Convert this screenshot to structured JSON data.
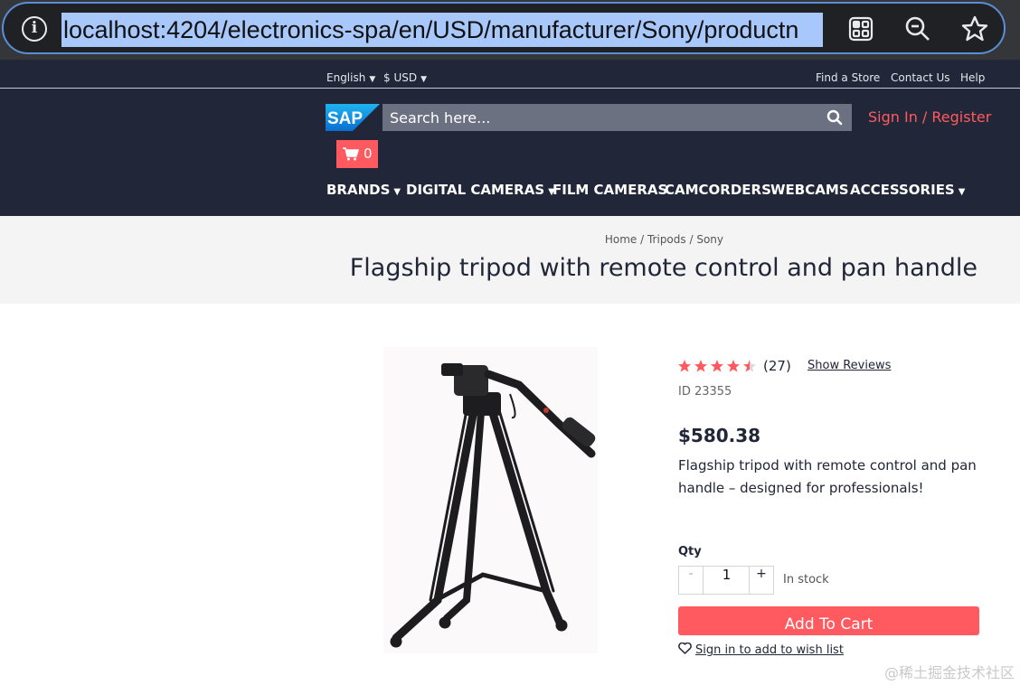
{
  "browser": {
    "url": "localhost:4204/electronics-spa/en/USD/manufacturer/Sony/productn"
  },
  "header": {
    "language": "English",
    "currency": "$ USD",
    "utility_links": [
      "Find a Store",
      "Contact Us",
      "Help"
    ],
    "logo_text": "SAP",
    "search_placeholder": "Search here...",
    "signin": "Sign In / Register",
    "cart_count": "0",
    "nav": [
      "BRANDS",
      "DIGITAL CAMERAS",
      "FILM CAMERAS",
      "CAMCORDERS",
      "WEBCAMS",
      "ACCESSORIES"
    ]
  },
  "breadcrumb": [
    "Home",
    "Tripods",
    "Sony"
  ],
  "product": {
    "title": "Flagship tripod with remote control and pan handle",
    "rating": 4.5,
    "review_count": "(27)",
    "show_reviews": "Show Reviews",
    "id": "ID 23355",
    "price": "$580.38",
    "summary": "Flagship tripod with remote control and pan handle – designed for professionals!",
    "qty_label": "Qty",
    "qty_minus": "-",
    "qty_value": "1",
    "qty_plus": "+",
    "stock": "In stock",
    "add_to_cart": "Add To Cart",
    "wishlist": "Sign in to add to wish list"
  },
  "watermark": "@稀土掘金技术社区",
  "colors": {
    "accent": "#ff5a5f",
    "header_bg": "#212738",
    "url_highlight": "#a8c7fa"
  }
}
